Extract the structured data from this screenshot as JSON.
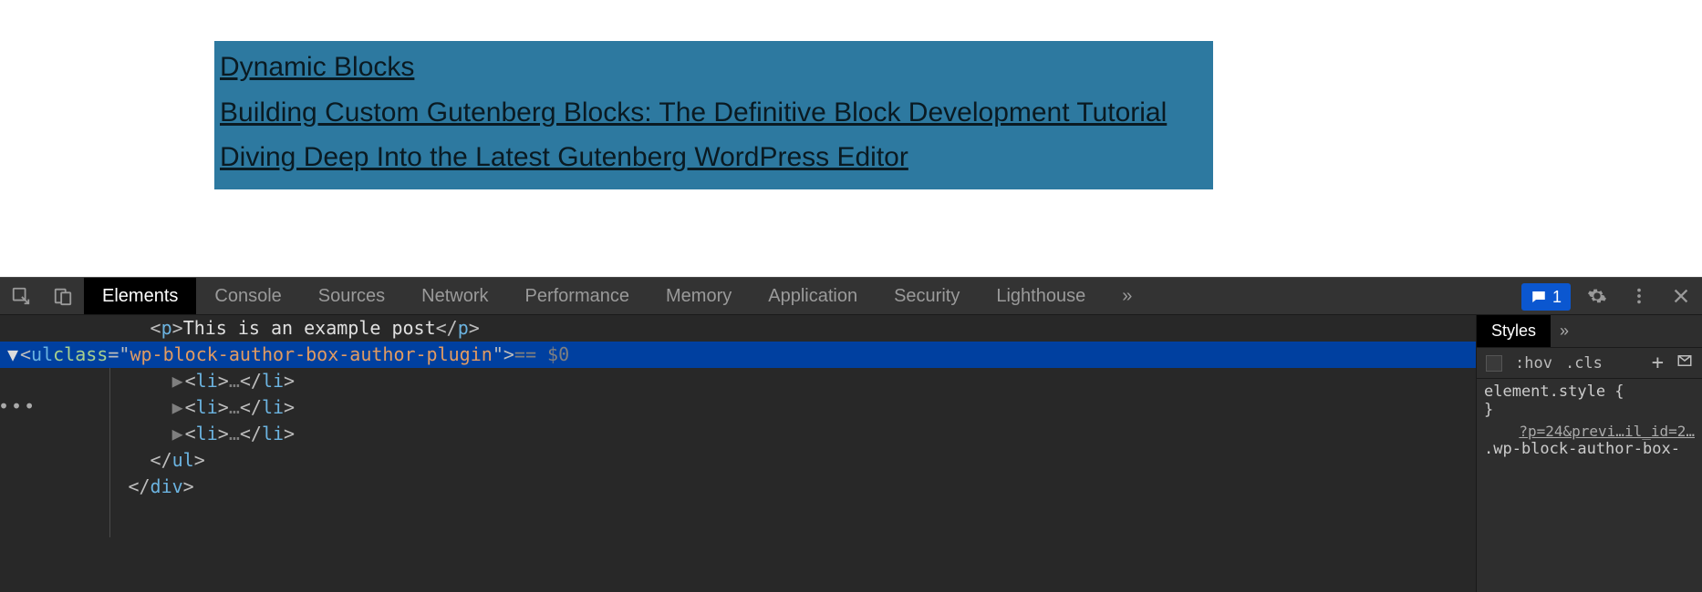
{
  "page": {
    "links": [
      "Dynamic Blocks",
      "Building Custom Gutenberg Blocks: The Definitive Block Development Tutorial",
      "Diving Deep Into the Latest Gutenberg WordPress Editor"
    ]
  },
  "devtools": {
    "tabs": [
      "Elements",
      "Console",
      "Sources",
      "Network",
      "Performance",
      "Memory",
      "Application",
      "Security",
      "Lighthouse"
    ],
    "active_tab": "Elements",
    "overflow": "»",
    "feedback_count": "1",
    "dom": {
      "p_text": "This is an example post",
      "ul_class": "wp-block-author-box-author-plugin",
      "selected_suffix": "== $0",
      "li_count": 3
    },
    "styles": {
      "tab_label": "Styles",
      "overflow": "»",
      "hov": ":hov",
      "cls": ".cls",
      "element_style_open": "element.style {",
      "element_style_close": "}",
      "source_link": "?p=24&previ…il_id=2…",
      "selector_partial": ".wp-block-author-box-"
    }
  }
}
